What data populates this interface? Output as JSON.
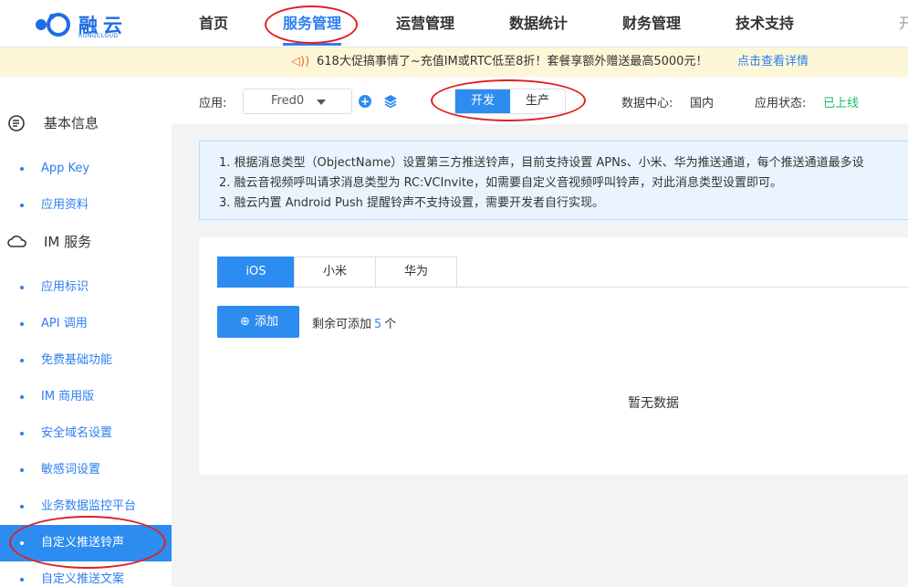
{
  "brand": {
    "name": "融云",
    "sub": "RONGCLOUD"
  },
  "nav": {
    "items": [
      "首页",
      "服务管理",
      "运营管理",
      "数据统计",
      "财务管理",
      "技术支持",
      "开"
    ],
    "active": "服务管理"
  },
  "banner": {
    "icon": "speaker-icon",
    "text": "618大促搞事情了~充值IM或RTC低至8折！套餐享额外赠送最高5000元！",
    "link": "点击查看详情"
  },
  "sidebar": {
    "group1": "基本信息",
    "group1_items": [
      "App Key",
      "应用资料"
    ],
    "group2": "IM 服务",
    "group2_items": [
      "应用标识",
      "API 调用",
      "免费基础功能",
      "IM 商用版",
      "安全域名设置",
      "敏感词设置",
      "业务数据监控平台",
      "自定义推送铃声",
      "自定义推送文案"
    ],
    "active": "自定义推送铃声"
  },
  "appbar": {
    "app_label": "应用:",
    "app_value": "Fred0",
    "env_dev": "开发",
    "env_prod": "生产",
    "dc_label": "数据中心:",
    "dc_value": "国内",
    "status_label": "应用状态:",
    "status_value": "已上线"
  },
  "notice": {
    "lines": [
      "1.  根据消息类型（ObjectName）设置第三方推送铃声，目前支持设置 APNs、小米、华为推送通道，每个推送通道最多设",
      "2.  融云音视频呼叫请求消息类型为 RC:VCInvite，如需要自定义音视频呼叫铃声，对此消息类型设置即可。",
      "3.  融云内置 Android Push 提醒铃声不支持设置，需要开发者自行实现。"
    ]
  },
  "card": {
    "tabs": [
      "iOS",
      "小米",
      "华为"
    ],
    "add_label": "添加",
    "remain_prefix": "剩余可添加",
    "remain_count": "5",
    "remain_suffix": "个",
    "empty_text": "暂无数据"
  },
  "colors": {
    "accent": "#2d8cf0",
    "status_online": "#19be6b",
    "annotation": "#e12020"
  }
}
